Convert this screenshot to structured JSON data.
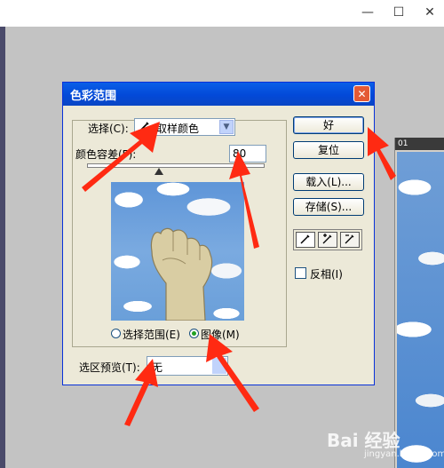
{
  "window": {
    "min_glyph": "—",
    "max_glyph": "☐",
    "close_glyph": "✕"
  },
  "document": {
    "tab_label": "01"
  },
  "dialog": {
    "title": "色彩范围",
    "close_glyph": "✕",
    "select_label": "选择(C):",
    "select_icon": "eyedropper-icon",
    "select_value": "取样颜色",
    "fuzziness_label": "颜色容差(F):",
    "fuzziness_value": "80",
    "fuzziness_level": 0.4,
    "radio_selection": "选择范围(E)",
    "radio_image": "图像(M)",
    "selected_radio": "image",
    "preview_label": "选区预览(T):",
    "preview_value": "无",
    "buttons": {
      "ok": "好",
      "reset": "复位",
      "load": "载入(L)...",
      "save": "存储(S)..."
    },
    "tools": [
      "eyedropper-icon",
      "eyedropper-plus-icon",
      "eyedropper-minus-icon"
    ],
    "invert_label": "反相(I)",
    "invert_checked": false
  },
  "watermark": {
    "text": "Bai 经验",
    "sub": "jingyan.baidu.com"
  },
  "colors": {
    "arrow": "#ff2a12",
    "titlebar": "#0a5fe8",
    "dialog_bg": "#ece9d8"
  }
}
